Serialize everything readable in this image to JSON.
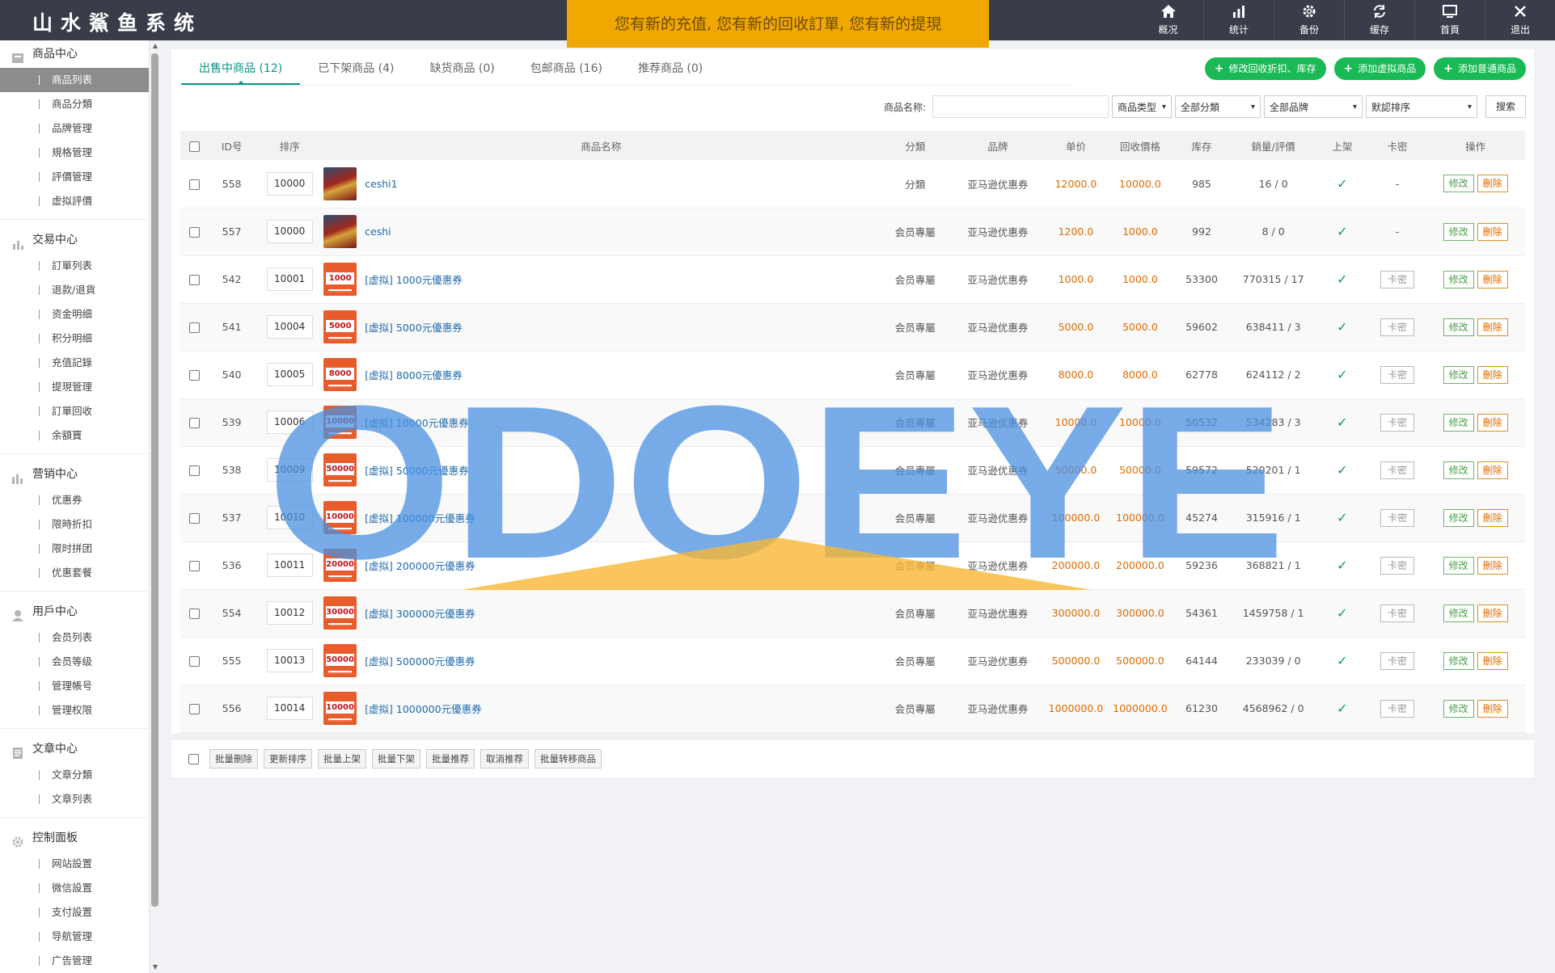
{
  "app": {
    "title": "山水鯊鱼系统"
  },
  "notice": {
    "text": "您有新的充值, 您有新的回收訂單, 您有新的提現"
  },
  "topnav": [
    {
      "label": "概况",
      "icon": "home-icon"
    },
    {
      "label": "统计",
      "icon": "bar-chart-icon"
    },
    {
      "label": "备份",
      "icon": "gear-icon"
    },
    {
      "label": "缓存",
      "icon": "refresh-icon"
    },
    {
      "label": "首頁",
      "icon": "monitor-icon"
    },
    {
      "label": "退出",
      "icon": "close-icon"
    }
  ],
  "sidebar": [
    {
      "title": "商品中心",
      "icon": "box-icon",
      "items": [
        "商品列表",
        "商品分類",
        "品牌管理",
        "規格管理",
        "評價管理",
        "虚拟評價"
      ],
      "active": 0
    },
    {
      "title": "交易中心",
      "icon": "bar-chart-icon",
      "items": [
        "訂單列表",
        "退款/退貨",
        "资金明细",
        "积分明细",
        "充值記錄",
        "提現管理",
        "訂單回收",
        "余額寶"
      ]
    },
    {
      "title": "营销中心",
      "icon": "chart-icon",
      "items": [
        "优惠券",
        "限時折扣",
        "限时拼团",
        "优惠套餐"
      ]
    },
    {
      "title": "用戶中心",
      "icon": "user-icon",
      "items": [
        "会员列表",
        "会员等级",
        "管理帳号",
        "管理权限"
      ]
    },
    {
      "title": "文章中心",
      "icon": "document-icon",
      "items": [
        "文章分類",
        "文章列表"
      ]
    },
    {
      "title": "控制面板",
      "icon": "gear-icon",
      "items": [
        "网站設置",
        "微信設置",
        "支付設置",
        "导航管理",
        "广告管理"
      ]
    }
  ],
  "tabs": [
    "出售中商品 (12)",
    "已下架商品 (4)",
    "缺货商品 (0)",
    "包邮商品 (16)",
    "推荐商品 (0)"
  ],
  "actions": {
    "edit_recycle": "修改回收折扣、库存",
    "add_virtual": "添加虚拟商品",
    "add_normal": "添加普通商品"
  },
  "search": {
    "label": "商品名称:",
    "type": "商品类型",
    "category": "全部分類",
    "brand": "全部品牌",
    "sort": "默認排序",
    "button": "搜索"
  },
  "table": {
    "headers": [
      "ID号",
      "排序",
      "商品名称",
      "分類",
      "品牌",
      "单价",
      "回收價格",
      "库存",
      "銷量/評價",
      "上架",
      "卡密",
      "操作"
    ],
    "rows": [
      {
        "id": "558",
        "order": "10000",
        "thumb": "hero",
        "badge": "",
        "name": "ceshi1",
        "cat": "分類",
        "brand": "亚马逊优惠券",
        "price": "12000.0",
        "recycle": "10000.0",
        "stock": "985",
        "sales": "16 / 0",
        "card": "-"
      },
      {
        "id": "557",
        "order": "10000",
        "thumb": "hero",
        "badge": "",
        "name": "ceshi",
        "cat": "会员專屬",
        "brand": "亚马逊优惠券",
        "price": "1200.0",
        "recycle": "1000.0",
        "stock": "992",
        "sales": "8 / 0",
        "card": "-"
      },
      {
        "id": "542",
        "order": "10001",
        "thumb": "coupon",
        "badge": "1000",
        "name": "[虚拟] 1000元優惠券",
        "cat": "会员專屬",
        "brand": "亚马逊优惠券",
        "price": "1000.0",
        "recycle": "1000.0",
        "stock": "53300",
        "sales": "770315 / 17",
        "card": "卡密"
      },
      {
        "id": "541",
        "order": "10004",
        "thumb": "coupon",
        "badge": "5000",
        "name": "[虚拟] 5000元優惠券",
        "cat": "会员專屬",
        "brand": "亚马逊优惠券",
        "price": "5000.0",
        "recycle": "5000.0",
        "stock": "59602",
        "sales": "638411 / 3",
        "card": "卡密"
      },
      {
        "id": "540",
        "order": "10005",
        "thumb": "coupon",
        "badge": "8000",
        "name": "[虚拟] 8000元優惠券",
        "cat": "会员專屬",
        "brand": "亚马逊优惠券",
        "price": "8000.0",
        "recycle": "8000.0",
        "stock": "62778",
        "sales": "624112 / 2",
        "card": "卡密"
      },
      {
        "id": "539",
        "order": "10006",
        "thumb": "coupon",
        "badge": "10000",
        "name": "[虚拟] 10000元優惠券",
        "cat": "会员專屬",
        "brand": "亚马逊优惠券",
        "price": "10000.0",
        "recycle": "10000.0",
        "stock": "50532",
        "sales": "534283 / 3",
        "card": "卡密"
      },
      {
        "id": "538",
        "order": "10009",
        "thumb": "coupon",
        "badge": "50000",
        "name": "[虚拟] 50000元優惠券",
        "cat": "会员專屬",
        "brand": "亚马逊优惠券",
        "price": "50000.0",
        "recycle": "50000.0",
        "stock": "59572",
        "sales": "520201 / 1",
        "card": "卡密"
      },
      {
        "id": "537",
        "order": "10010",
        "thumb": "coupon",
        "badge": "100000",
        "name": "[虚拟] 100000元優惠券",
        "cat": "会员專屬",
        "brand": "亚马逊优惠券",
        "price": "100000.0",
        "recycle": "100000.0",
        "stock": "45274",
        "sales": "315916 / 1",
        "card": "卡密"
      },
      {
        "id": "536",
        "order": "10011",
        "thumb": "coupon",
        "badge": "200000",
        "name": "[虚拟] 200000元優惠券",
        "cat": "会员專屬",
        "brand": "亚马逊优惠券",
        "price": "200000.0",
        "recycle": "200000.0",
        "stock": "59236",
        "sales": "368821 / 1",
        "card": "卡密"
      },
      {
        "id": "554",
        "order": "10012",
        "thumb": "coupon",
        "badge": "300000",
        "name": "[虚拟] 300000元優惠券",
        "cat": "会员專屬",
        "brand": "亚马逊优惠券",
        "price": "300000.0",
        "recycle": "300000.0",
        "stock": "54361",
        "sales": "1459758 / 1",
        "card": "卡密"
      },
      {
        "id": "555",
        "order": "10013",
        "thumb": "coupon",
        "badge": "500000",
        "name": "[虚拟] 500000元優惠券",
        "cat": "会员專屬",
        "brand": "亚马逊优惠券",
        "price": "500000.0",
        "recycle": "500000.0",
        "stock": "64144",
        "sales": "233039 / 0",
        "card": "卡密"
      },
      {
        "id": "556",
        "order": "10014",
        "thumb": "coupon",
        "badge": "1000000",
        "name": "[虚拟] 1000000元優惠券",
        "cat": "会员專屬",
        "brand": "亚马逊优惠券",
        "price": "1000000.0",
        "recycle": "1000000.0",
        "stock": "61230",
        "sales": "4568962 / 0",
        "card": "卡密"
      }
    ],
    "edit_label": "修改",
    "delete_label": "刪除"
  },
  "batch": [
    "批量刪除",
    "更新排序",
    "批量上架",
    "批量下架",
    "批量推荐",
    "取消推荐",
    "批量转移商品"
  ],
  "watermark": "ODOEYE",
  "colors": {
    "topbar": "#393d49",
    "notice": "#f0a800",
    "accent": "#0a9488",
    "green": "#19b955",
    "orange": "#e06b00",
    "watermark_blue": "#4a90e2",
    "watermark_yellow": "#f7b733"
  }
}
